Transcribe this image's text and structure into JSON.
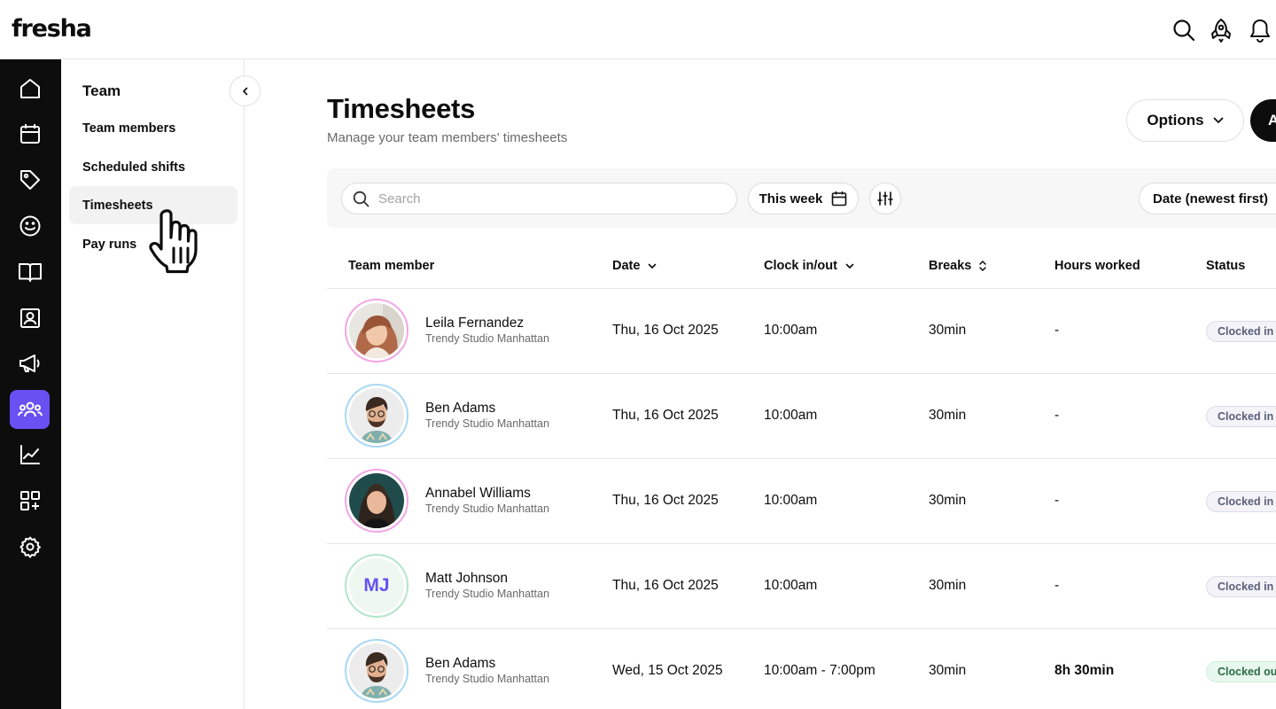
{
  "app": {
    "logo": "fresha"
  },
  "subnav": {
    "title": "Team",
    "items": [
      {
        "label": "Team members"
      },
      {
        "label": "Scheduled shifts"
      },
      {
        "label": "Timesheets"
      },
      {
        "label": "Pay runs"
      }
    ]
  },
  "page": {
    "title": "Timesheets",
    "subtitle": "Manage your team members' timesheets",
    "options_label": "Options",
    "add_label": "A"
  },
  "filters": {
    "search_placeholder": "Search",
    "range_label": "This week",
    "sort_label": "Date (newest first)"
  },
  "table": {
    "headers": {
      "member": "Team member",
      "date": "Date",
      "clock": "Clock in/out",
      "breaks": "Breaks",
      "hours": "Hours worked",
      "status": "Status"
    },
    "rows": [
      {
        "name": "Leila Fernandez",
        "location": "Trendy Studio Manhattan",
        "date": "Thu, 16 Oct 2025",
        "clock": "10:00am",
        "breaks": "30min",
        "hours": "-",
        "status": "Clocked in"
      },
      {
        "name": "Ben Adams",
        "location": "Trendy Studio Manhattan",
        "date": "Thu, 16 Oct 2025",
        "clock": "10:00am",
        "breaks": "30min",
        "hours": "-",
        "status": "Clocked in"
      },
      {
        "name": "Annabel Williams",
        "location": "Trendy Studio Manhattan",
        "date": "Thu, 16 Oct 2025",
        "clock": "10:00am",
        "breaks": "30min",
        "hours": "-",
        "status": "Clocked in"
      },
      {
        "name": "Matt Johnson",
        "initials": "MJ",
        "location": "Trendy Studio Manhattan",
        "date": "Thu, 16 Oct 2025",
        "clock": "10:00am",
        "breaks": "30min",
        "hours": "-",
        "status": "Clocked in"
      },
      {
        "name": "Ben Adams",
        "location": "Trendy Studio Manhattan",
        "date": "Wed, 15 Oct 2025",
        "clock": "10:00am - 7:00pm",
        "breaks": "30min",
        "hours": "8h 30min",
        "status": "Clocked out"
      }
    ]
  },
  "colors": {
    "accent": "#6950f3",
    "rail_bg": "#0d0d0d"
  }
}
